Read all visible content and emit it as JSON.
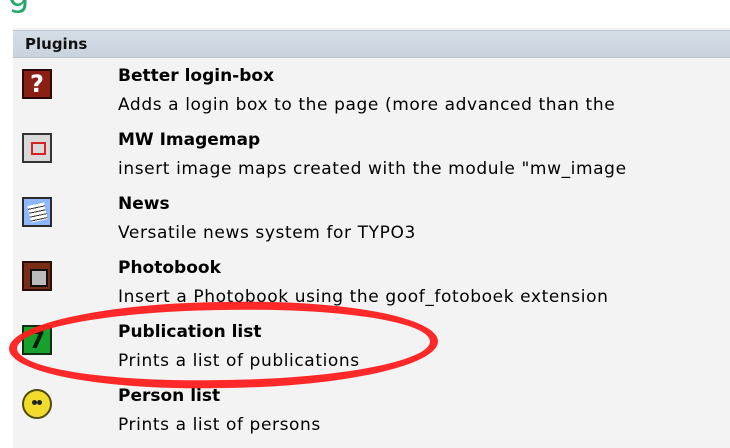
{
  "page": {
    "top_fragment": "g"
  },
  "panel": {
    "title": "Plugins"
  },
  "plugins": [
    {
      "title": "Better login-box",
      "description": "Adds a login box to the page (more advanced than the"
    },
    {
      "title": "MW Imagemap",
      "description": "insert image maps created with the module \"mw_image"
    },
    {
      "title": "News",
      "description": "Versatile news system for TYPO3"
    },
    {
      "title": "Photobook",
      "description": "Insert a Photobook using the goof_fotoboek extension"
    },
    {
      "title": "Publication list",
      "description": "Prints a list of publications"
    },
    {
      "title": "Person list",
      "description": "Prints a list of persons"
    }
  ],
  "icons": {
    "better_login": "question-box-icon",
    "mw_imagemap": "imagemap-icon",
    "news": "news-icon",
    "photobook": "photobook-icon",
    "publication_list": "number-7-icon",
    "person_list": "person-icon"
  },
  "colors": {
    "accent": "#24a86a",
    "header_bg": "#d5dde6",
    "annotation": "#ff1d1d"
  }
}
